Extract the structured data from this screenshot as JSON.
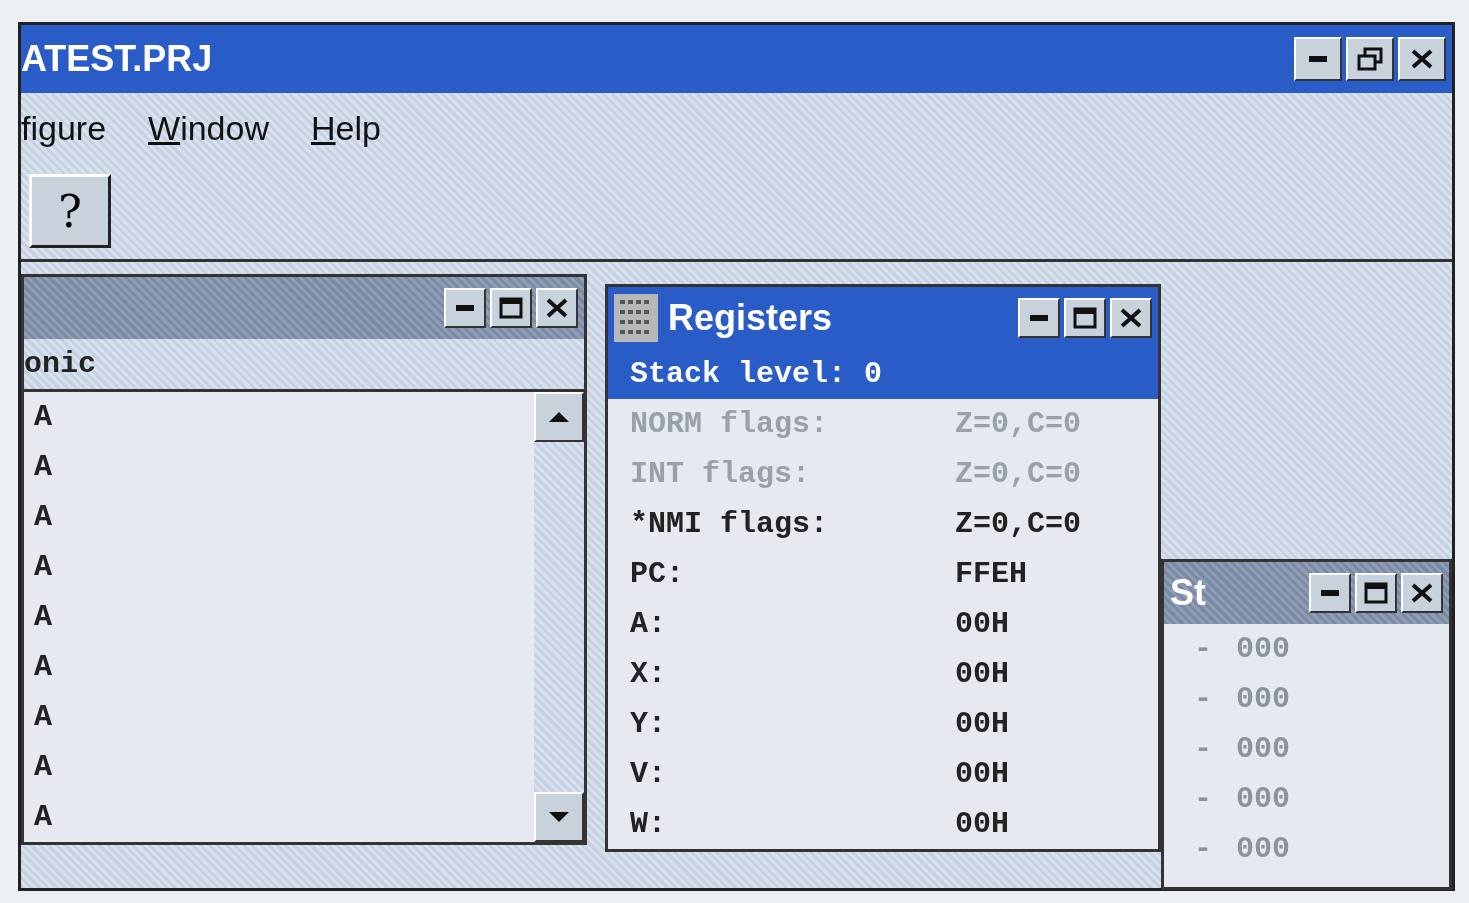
{
  "window": {
    "title": "ATEST.PRJ"
  },
  "menu": [
    {
      "label": "figure",
      "mnemonic": false
    },
    {
      "label": "Window",
      "mnemonic": true
    },
    {
      "label": "Help",
      "mnemonic": true
    }
  ],
  "toolbar": [
    {
      "label": "?"
    }
  ],
  "code_window": {
    "active": false,
    "column_header": "onic",
    "rows": [
      "A",
      "A",
      "A",
      "A",
      "A",
      "A",
      "A",
      "A",
      "A"
    ]
  },
  "registers_window": {
    "title": "Registers",
    "active": true,
    "rows": [
      {
        "label": "Stack level: 0",
        "value": "",
        "selected": true,
        "dimmed": false
      },
      {
        "label": "NORM flags:",
        "value": "Z=0,C=0",
        "selected": false,
        "dimmed": true
      },
      {
        "label": "INT flags:",
        "value": "Z=0,C=0",
        "selected": false,
        "dimmed": true
      },
      {
        "label": "*NMI flags:",
        "value": "Z=0,C=0",
        "selected": false,
        "dimmed": false
      },
      {
        "label": "PC:",
        "value": "FFEH",
        "selected": false,
        "dimmed": false
      },
      {
        "label": "A:",
        "value": "00H",
        "selected": false,
        "dimmed": false
      },
      {
        "label": "X:",
        "value": "00H",
        "selected": false,
        "dimmed": false
      },
      {
        "label": "Y:",
        "value": "00H",
        "selected": false,
        "dimmed": false
      },
      {
        "label": "V:",
        "value": "00H",
        "selected": false,
        "dimmed": false
      },
      {
        "label": "W:",
        "value": "00H",
        "selected": false,
        "dimmed": false
      }
    ]
  },
  "stack_window": {
    "title": "St",
    "active": false,
    "rows": [
      {
        "marker": "-",
        "value": "000"
      },
      {
        "marker": "-",
        "value": "000"
      },
      {
        "marker": "-",
        "value": "000"
      },
      {
        "marker": "-",
        "value": "000"
      },
      {
        "marker": "-",
        "value": "000"
      }
    ]
  }
}
